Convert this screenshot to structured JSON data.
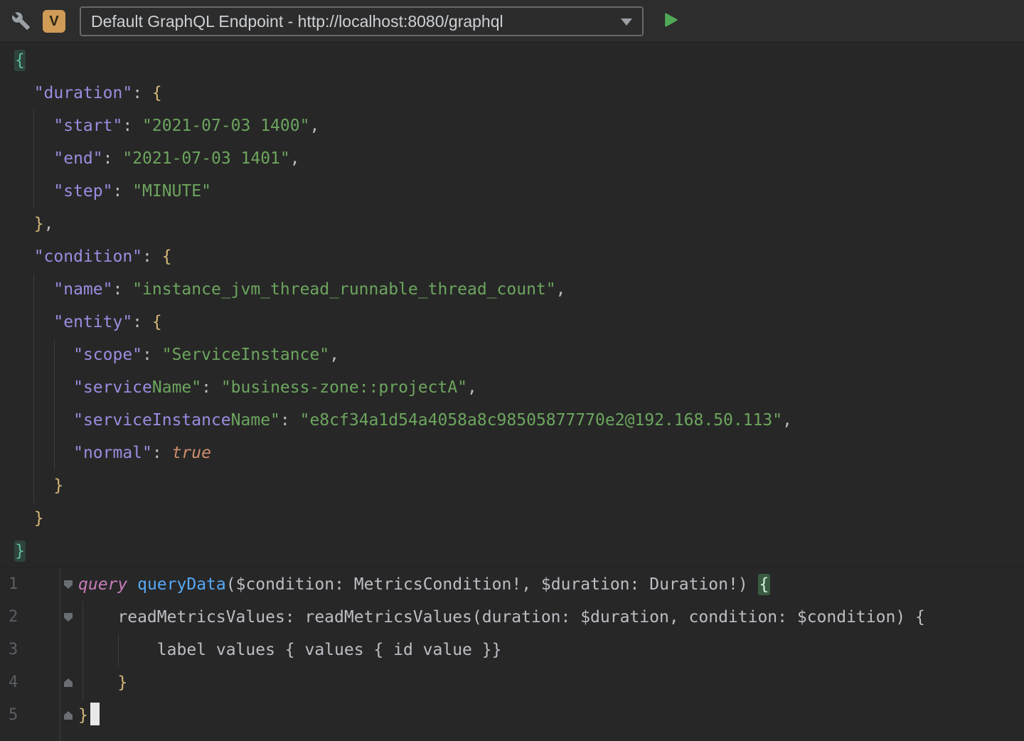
{
  "toolbar": {
    "vim_badge": "V",
    "endpoint_label": "Default GraphQL Endpoint - http://localhost:8080/graphql"
  },
  "colors": {
    "run_green": "#4fa855",
    "vim_badge_amber": "#cf9b57",
    "json_key_violet": "#9c8ce0",
    "string_green": "#6ca55e",
    "keyword_orange": "#cf8e6d",
    "brace_match_bg": "#3a5b41",
    "outer_brace_teal": "#5fbd9c",
    "editor_bg": "#272727",
    "toolbar_bg": "#2d2d2d"
  },
  "variables_editor": {
    "lines": [
      [
        {
          "t": "{",
          "c": "brace-outer"
        }
      ],
      [
        {
          "t": "  ",
          "c": "plain"
        },
        {
          "t": "\"duration\"",
          "c": "key"
        },
        {
          "t": ": ",
          "c": "plain"
        },
        {
          "t": "{",
          "c": "brace"
        }
      ],
      [
        {
          "t": "    ",
          "c": "plain"
        },
        {
          "t": "\"start\"",
          "c": "key"
        },
        {
          "t": ": ",
          "c": "plain"
        },
        {
          "t": "\"2021-07-03 1400\"",
          "c": "str"
        },
        {
          "t": ",",
          "c": "plain"
        }
      ],
      [
        {
          "t": "    ",
          "c": "plain"
        },
        {
          "t": "\"end\"",
          "c": "key"
        },
        {
          "t": ": ",
          "c": "plain"
        },
        {
          "t": "\"2021-07-03 1401\"",
          "c": "str"
        },
        {
          "t": ",",
          "c": "plain"
        }
      ],
      [
        {
          "t": "    ",
          "c": "plain"
        },
        {
          "t": "\"step\"",
          "c": "key"
        },
        {
          "t": ": ",
          "c": "plain"
        },
        {
          "t": "\"MINUTE\"",
          "c": "str"
        }
      ],
      [
        {
          "t": "  ",
          "c": "plain"
        },
        {
          "t": "}",
          "c": "brace"
        },
        {
          "t": ",",
          "c": "plain"
        }
      ],
      [
        {
          "t": "  ",
          "c": "plain"
        },
        {
          "t": "\"condition\"",
          "c": "key"
        },
        {
          "t": ": ",
          "c": "plain"
        },
        {
          "t": "{",
          "c": "brace"
        }
      ],
      [
        {
          "t": "    ",
          "c": "plain"
        },
        {
          "t": "\"name\"",
          "c": "key"
        },
        {
          "t": ": ",
          "c": "plain"
        },
        {
          "t": "\"instance_jvm_thread_runnable_thread_count\"",
          "c": "str"
        },
        {
          "t": ",",
          "c": "plain"
        }
      ],
      [
        {
          "t": "    ",
          "c": "plain"
        },
        {
          "t": "\"entity\"",
          "c": "key"
        },
        {
          "t": ": ",
          "c": "plain"
        },
        {
          "t": "{",
          "c": "brace"
        }
      ],
      [
        {
          "t": "      ",
          "c": "plain"
        },
        {
          "t": "\"scope\"",
          "c": "key"
        },
        {
          "t": ": ",
          "c": "plain"
        },
        {
          "t": "\"ServiceInstance\"",
          "c": "str"
        },
        {
          "t": ",",
          "c": "plain"
        }
      ],
      [
        {
          "t": "      ",
          "c": "plain"
        },
        {
          "t": "\"service",
          "c": "key"
        },
        {
          "t": "Name\"",
          "c": "str"
        },
        {
          "t": ": ",
          "c": "plain"
        },
        {
          "t": "\"business-zone::projectA\"",
          "c": "str"
        },
        {
          "t": ",",
          "c": "plain"
        }
      ],
      [
        {
          "t": "      ",
          "c": "plain"
        },
        {
          "t": "\"serviceInstance",
          "c": "key"
        },
        {
          "t": "Name\"",
          "c": "str"
        },
        {
          "t": ": ",
          "c": "plain"
        },
        {
          "t": "\"e8cf34a1d54a4058a8c98505877770e2@192.168.50.113\"",
          "c": "str"
        },
        {
          "t": ",",
          "c": "plain"
        }
      ],
      [
        {
          "t": "      ",
          "c": "plain"
        },
        {
          "t": "\"normal\"",
          "c": "key"
        },
        {
          "t": ": ",
          "c": "plain"
        },
        {
          "t": "true",
          "c": "kw"
        }
      ],
      [
        {
          "t": "    ",
          "c": "plain"
        },
        {
          "t": "}",
          "c": "brace"
        }
      ],
      [
        {
          "t": "  ",
          "c": "plain"
        },
        {
          "t": "}",
          "c": "brace"
        }
      ],
      [
        {
          "t": "}",
          "c": "brace-outer"
        }
      ]
    ]
  },
  "query_editor": {
    "gutter": [
      {
        "num": "1",
        "fold": "start"
      },
      {
        "num": "2",
        "fold": "start"
      },
      {
        "num": "3",
        "fold": ""
      },
      {
        "num": "4",
        "fold": "end"
      },
      {
        "num": "5",
        "fold": "end"
      }
    ],
    "lines": [
      [
        {
          "t": "query",
          "c": "gql-kw"
        },
        {
          "t": " ",
          "c": "plain"
        },
        {
          "t": "queryData",
          "c": "gql-fn"
        },
        {
          "t": "(",
          "c": "plain"
        },
        {
          "t": "$condition",
          "c": "plain"
        },
        {
          "t": ": ",
          "c": "plain"
        },
        {
          "t": "MetricsCondition!",
          "c": "plain"
        },
        {
          "t": ", ",
          "c": "plain"
        },
        {
          "t": "$duration",
          "c": "plain"
        },
        {
          "t": ": ",
          "c": "plain"
        },
        {
          "t": "Duration!",
          "c": "plain"
        },
        {
          "t": ") ",
          "c": "plain"
        },
        {
          "t": "{",
          "c": "brace-hl"
        }
      ],
      [
        {
          "t": "    readMetricsValues: readMetricsValues(duration: $duration, condition: $condition) {",
          "c": "plain"
        }
      ],
      [
        {
          "t": "        label values { values { id value }}",
          "c": "plain"
        }
      ],
      [
        {
          "t": "    ",
          "c": "plain"
        },
        {
          "t": "}",
          "c": "brace"
        }
      ],
      [
        {
          "t": "}",
          "c": "brace"
        },
        {
          "t": "",
          "c": "cursor"
        }
      ]
    ]
  }
}
